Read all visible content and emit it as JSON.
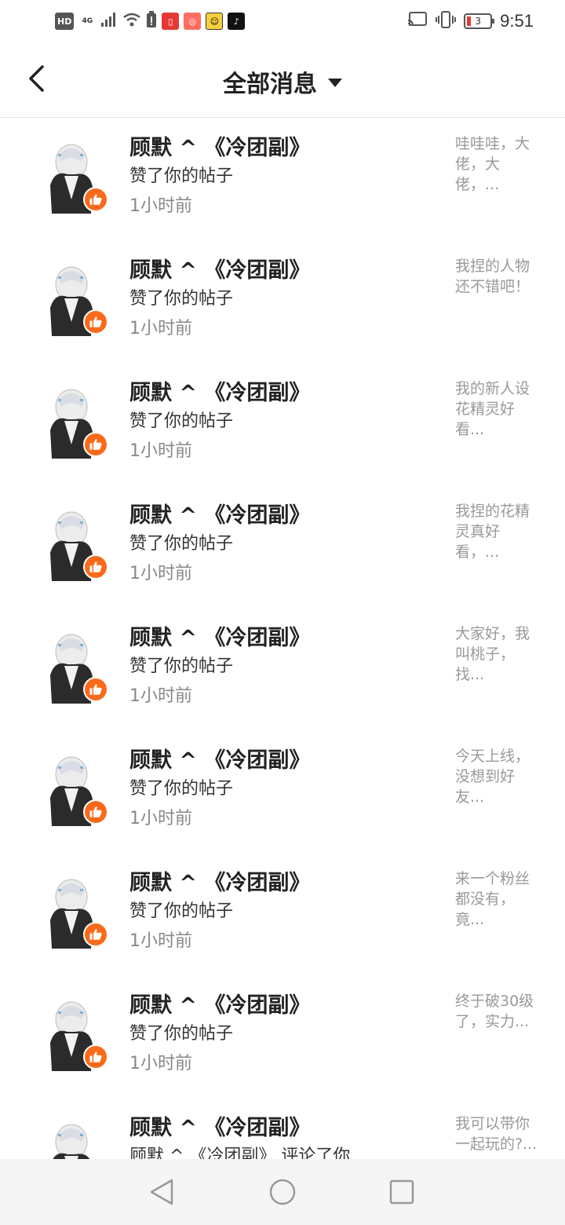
{
  "status_bar": {
    "left_icons": [
      "hd-icon",
      "4g-icon",
      "signal-icon",
      "wifi-icon",
      "battery-saver-icon",
      "app-book-icon",
      "app-video-icon",
      "app-game-icon",
      "tiktok-icon"
    ],
    "hd": "HD",
    "network": "4G",
    "battery_level": "3",
    "time": "9:51"
  },
  "header": {
    "title": "全部消息",
    "back_icon": "chevron-left-icon",
    "dropdown_icon": "caret-down-icon"
  },
  "colors": {
    "accent": "#fb6a1a",
    "muted_text": "#888888",
    "preview_text": "#999999"
  },
  "messages": [
    {
      "name": "顾默 ^ 《冷团副》",
      "action": "赞了你的帖子",
      "time": "1小时前",
      "preview": "哇哇哇，大佬，大佬，..."
    },
    {
      "name": "顾默 ^ 《冷团副》",
      "action": "赞了你的帖子",
      "time": "1小时前",
      "preview": "我捏的人物还不错吧！"
    },
    {
      "name": "顾默 ^ 《冷团副》",
      "action": "赞了你的帖子",
      "time": "1小时前",
      "preview": "我的新人设花精灵好看..."
    },
    {
      "name": "顾默 ^ 《冷团副》",
      "action": "赞了你的帖子",
      "time": "1小时前",
      "preview": "我捏的花精灵真好看，..."
    },
    {
      "name": "顾默 ^ 《冷团副》",
      "action": "赞了你的帖子",
      "time": "1小时前",
      "preview": "大家好，我叫桃子，找..."
    },
    {
      "name": "顾默 ^ 《冷团副》",
      "action": "赞了你的帖子",
      "time": "1小时前",
      "preview": "今天上线，没想到好友..."
    },
    {
      "name": "顾默 ^ 《冷团副》",
      "action": "赞了你的帖子",
      "time": "1小时前",
      "preview": "来一个粉丝都没有，竟..."
    },
    {
      "name": "顾默 ^ 《冷团副》",
      "action": "赞了你的帖子",
      "time": "1小时前",
      "preview": "终于破30级了，实力..."
    },
    {
      "name": "顾默 ^ 《冷团副》",
      "action": "顾默 ^ 《冷团副》 评论了你",
      "time": "",
      "preview": "我可以带你一起玩的?..."
    }
  ],
  "nav": {
    "back": "triangle-back-icon",
    "home": "circle-home-icon",
    "recents": "square-recents-icon"
  }
}
